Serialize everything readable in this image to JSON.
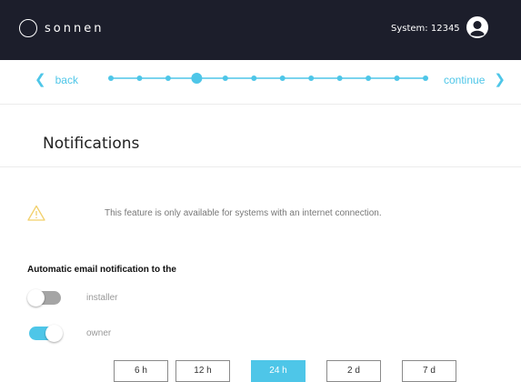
{
  "header": {
    "logo_text": "sonnen",
    "system_label": "System:",
    "system_id": "12345",
    "avatar_icon": "user-circle-icon"
  },
  "stepper": {
    "back_label": "back",
    "continue_label": "continue",
    "back_icon": "chevron-left-icon",
    "continue_icon": "chevron-right-icon",
    "total_steps": 12,
    "current_step": 4,
    "color": "#4ec6e8"
  },
  "page": {
    "title": "Notifications"
  },
  "warning": {
    "icon": "warning-triangle-icon",
    "text": "This feature is only available for systems with an internet connection.",
    "color": "#f2d06b"
  },
  "email_notification": {
    "title": "Automatic email notification to the",
    "recipients": [
      {
        "label": "installer",
        "enabled": false
      },
      {
        "label": "owner",
        "enabled": true
      }
    ]
  },
  "intervals": {
    "options": [
      "6 h",
      "12 h",
      "24 h",
      "2 d",
      "7 d"
    ],
    "selected": "24 h",
    "accent": "#4ec6e8"
  }
}
